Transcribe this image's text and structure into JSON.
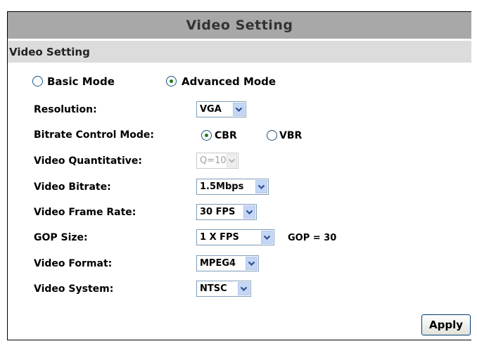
{
  "panel": {
    "title": "Video Setting",
    "section_title": "Video Setting"
  },
  "mode": {
    "basic_label": "Basic Mode",
    "advanced_label": "Advanced Mode",
    "selected": "Advanced Mode"
  },
  "fields": {
    "resolution": {
      "label": "Resolution:",
      "value": "VGA"
    },
    "bitrate_control": {
      "label": "Bitrate Control Mode:",
      "cbr_label": "CBR",
      "vbr_label": "VBR",
      "selected": "CBR"
    },
    "video_quantitative": {
      "label": "Video Quantitative:",
      "value": "Q=10",
      "disabled": true
    },
    "video_bitrate": {
      "label": "Video Bitrate:",
      "value": "1.5Mbps"
    },
    "video_frame_rate": {
      "label": "Video Frame Rate:",
      "value": "30 FPS"
    },
    "gop_size": {
      "label": "GOP Size:",
      "value": "1 X FPS",
      "note": "GOP = 30"
    },
    "video_format": {
      "label": "Video Format:",
      "value": "MPEG4"
    },
    "video_system": {
      "label": "Video System:",
      "value": "NTSC"
    }
  },
  "actions": {
    "apply_label": "Apply"
  },
  "icons": {
    "dropdown": "chevron-down-icon",
    "radio": "radio-icon"
  },
  "colors": {
    "title_bar": "#a8a8a8",
    "section_bar": "#dcdcdc",
    "dropdown_arrow_bg": "#c4d6f5",
    "radio_dot": "#1e7a1e"
  }
}
